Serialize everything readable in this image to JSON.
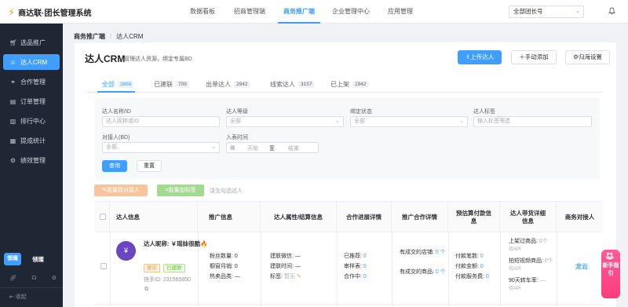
{
  "app": {
    "title": "商达联·团长管理系统"
  },
  "topnav": [
    "数据看板",
    "招商管理端",
    "商务推广端",
    "企业管理中心",
    "应用管理"
  ],
  "leader_select": {
    "value": "全部团长号"
  },
  "sidebar": {
    "items": [
      "选品推广",
      "达人CRM",
      "合作管理",
      "订单管理",
      "排行中心",
      "提成统计",
      "绩效管理"
    ],
    "user_avatar": "领璨",
    "user_name": "领璨",
    "collapse": "收起"
  },
  "breadcrumb": {
    "level1": "商务推广端",
    "sep": "/",
    "level2": "达人CRM"
  },
  "page": {
    "title": "达人CRM",
    "subtitle": "管理达人资源，绑定专属BD",
    "upload_btn": "上传达人",
    "manual_add_btn": "手动添加",
    "setting_btn": "归海设置"
  },
  "tabs": [
    {
      "label": "全部",
      "count": "3868"
    },
    {
      "label": "已建联",
      "count": "709"
    },
    {
      "label": "出单达人",
      "count": "2942"
    },
    {
      "label": "线索达人",
      "count": "3157"
    },
    {
      "label": "已上架",
      "count": "2942"
    }
  ],
  "filters": {
    "name_label": "达人名称/ID",
    "name_placeholder": "达人昵称或ID",
    "level_label": "达人等级",
    "level_value": "全部",
    "bind_label": "绑定状态",
    "bind_value": "全部",
    "tag_label": "达人标签",
    "tag_placeholder": "输入标签筛选",
    "bd_label": "对接人(BD)",
    "bd_value": "全部",
    "date_label": "入表时间",
    "date_start": "开始",
    "date_to": "至",
    "date_end": "结束",
    "query_btn": "查询",
    "reset_btn": "重置"
  },
  "toolbar": {
    "batch_bd": "批量改对接人",
    "batch_tag": "批量加标签",
    "hint": "请先勾选达人"
  },
  "table": {
    "headers": [
      "达人信息",
      "推广信息",
      "达人属性/结算信息",
      "合作进展详情",
      "推广合作详情",
      "预估算付款信息",
      "达人带货详细信息",
      "商务对接人"
    ],
    "row": {
      "avatar": "¥",
      "nickname": "达人昵称: ￥瑶妹很酷🔥",
      "tag1": "腰部",
      "tag2": "已建联",
      "kuaishou_id": "快手ID: 231565850",
      "fans_label": "粉丝数量:",
      "fans_value": "0",
      "window_label": "橱窗月销:",
      "window_value": "0",
      "hot_label": "热卖品类:",
      "hot_value": "—",
      "wechat_label": "建联微信:",
      "wechat_value": "—",
      "time_label": "建联时间:",
      "time_value": "—",
      "tags_label": "标签:",
      "tags_value": "暂无",
      "rec_label": "已推荐:",
      "rec_value": "0",
      "review_label": "审样表:",
      "review_value": "0",
      "coop_label": "合作中:",
      "coop_value": "0",
      "shops_label": "有成交的店铺:",
      "shops_value": "0",
      "shops_unit": "个",
      "goods_label": "有成交的商品:",
      "goods_value": "0",
      "goods_unit": "个",
      "pay_cnt_label": "付款笔数:",
      "pay_cnt_value": "0",
      "pay_amt_label": "付款金额:",
      "pay_amt_value": "0",
      "fee_label": "付款服务费:",
      "fee_value": "0",
      "listed_label": "上架过商品:",
      "listed_value": "0个",
      "listed_src": "待API",
      "video_label": "拍短视频商品:",
      "video_value": "0个",
      "video_src": "待API",
      "conv_label": "90天转车率:",
      "conv_value": "—",
      "conv_src": "待API",
      "bd_name": "龙云"
    }
  },
  "float_guide": {
    "text": "新手指引",
    "icon": "fox-icon"
  },
  "colors": {
    "primary": "#409eff",
    "sidebar_bg": "#1f2735",
    "batch_bd_bg": "#f7c59d",
    "batch_tag_bg": "#a3d990",
    "guide_pink": "#ff4d8a"
  }
}
